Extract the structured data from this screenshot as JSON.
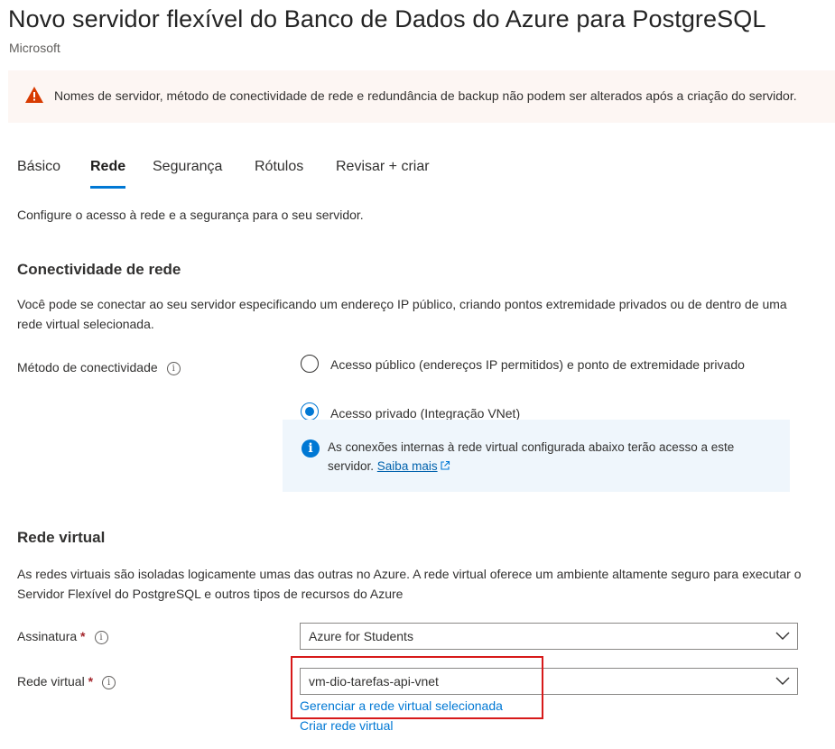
{
  "header": {
    "title": "Novo servidor flexível do Banco de Dados do Azure para PostgreSQL",
    "publisher": "Microsoft"
  },
  "warning": {
    "icon": "warning-triangle-icon",
    "color": "#d83b01",
    "text": "Nomes de servidor, método de conectividade de rede e redundância de backup não podem ser alterados após a criação do servidor."
  },
  "tabs": [
    {
      "label": "Básico",
      "active": false
    },
    {
      "label": "Rede",
      "active": true
    },
    {
      "label": "Segurança",
      "active": false
    },
    {
      "label": "Rótulos",
      "active": false
    },
    {
      "label": "Revisar + criar",
      "active": false
    }
  ],
  "intro": "Configure o acesso à rede e a segurança para o seu servidor.",
  "connectivity": {
    "heading": "Conectividade de rede",
    "description": "Você pode se conectar ao seu servidor especificando um endereço IP público, criando pontos extremidade privados ou de dentro de uma rede virtual selecionada.",
    "method_label": "Método de conectividade",
    "options": [
      {
        "label": "Acesso público (endereços IP permitidos) e ponto de extremidade privado",
        "selected": false
      },
      {
        "label": "Acesso privado (Integração VNet)",
        "selected": true
      }
    ],
    "info_text": "As conexões internas à rede virtual configurada abaixo terão acesso a este servidor.",
    "info_link": "Saiba mais"
  },
  "vnet": {
    "heading": "Rede virtual",
    "description": "As redes virtuais são isoladas logicamente umas das outras no Azure. A rede virtual oferece um ambiente altamente seguro para executar o Servidor Flexível do PostgreSQL e outros tipos de recursos do Azure",
    "subscription_label": "Assinatura",
    "subscription_value": "Azure for Students",
    "vnet_label": "Rede virtual",
    "vnet_value": "vm-dio-tarefas-api-vnet",
    "manage_link": "Gerenciar a rede virtual selecionada",
    "create_link": "Criar rede virtual",
    "required_marker": "*",
    "info_marker": "i"
  },
  "colors": {
    "accent": "#0078d4",
    "highlight_border": "#d71a1a",
    "warning_bg": "#fdf6f3",
    "info_bg": "#eff6fc"
  }
}
